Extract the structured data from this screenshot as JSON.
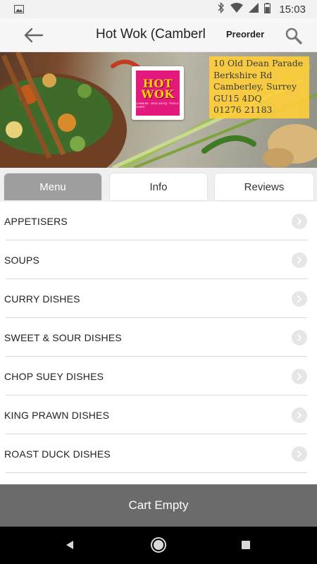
{
  "status_bar": {
    "time": "15:03",
    "icons": [
      "image-notification-icon",
      "bluetooth-icon",
      "wifi-icon",
      "signal-icon",
      "battery-icon"
    ]
  },
  "app_bar": {
    "title": "Hot Wok (Camberl",
    "preorder_label": "Preorder",
    "icons": [
      "back-arrow-icon",
      "search-icon"
    ]
  },
  "banner": {
    "logo": {
      "line1": "HOT",
      "line2": "WOK",
      "tagline": "CHINESE · WOK ANTIQ · FISH & CHIPS"
    },
    "address": [
      "10 Old Dean Parade",
      "Berkshire Rd",
      "Camberley, Surrey",
      "GU15 4DQ",
      "01276 21183"
    ]
  },
  "tabs": [
    {
      "label": "Menu",
      "active": true
    },
    {
      "label": "Info",
      "active": false
    },
    {
      "label": "Reviews",
      "active": false
    }
  ],
  "categories": [
    "APPETISERS",
    "SOUPS",
    "CURRY DISHES",
    "SWEET & SOUR DISHES",
    "CHOP SUEY DISHES",
    "KING PRAWN DISHES",
    "ROAST DUCK DISHES"
  ],
  "cart": {
    "label": "Cart Empty"
  },
  "colors": {
    "accent_tab": "#9e9e9e",
    "cart_bar": "#6b6b6b",
    "address_bg": "#ffce37",
    "logo_bg": "#e5197d",
    "logo_text": "#ffd200"
  }
}
